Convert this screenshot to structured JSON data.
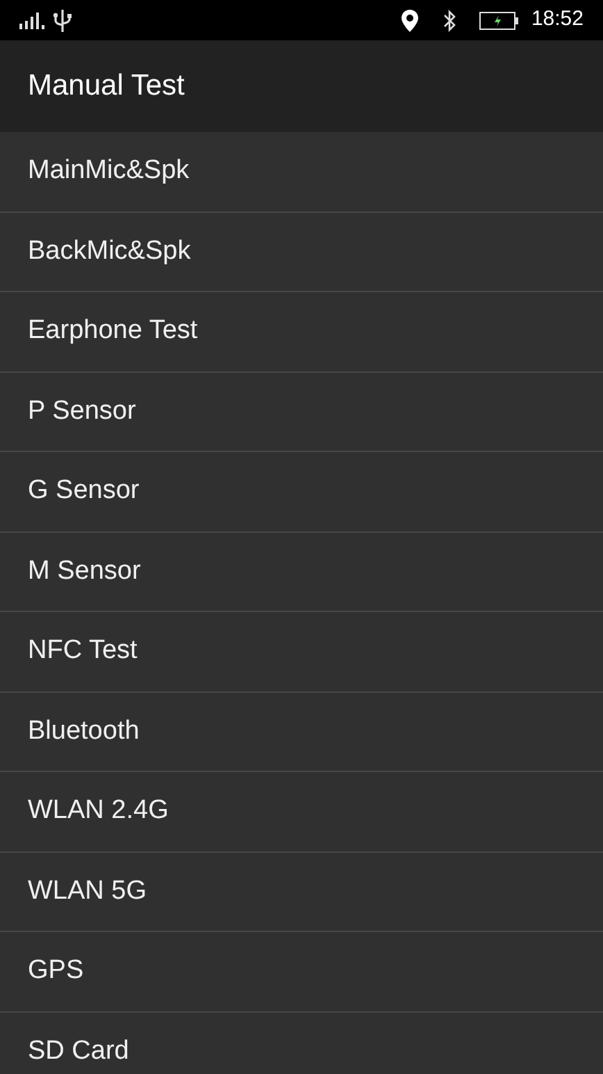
{
  "status_bar": {
    "time": "18:52"
  },
  "app_bar": {
    "title": "Manual Test"
  },
  "items": [
    {
      "label": "MainMic&Spk"
    },
    {
      "label": "BackMic&Spk"
    },
    {
      "label": "Earphone Test"
    },
    {
      "label": "P Sensor"
    },
    {
      "label": "G Sensor"
    },
    {
      "label": "M Sensor"
    },
    {
      "label": "NFC Test"
    },
    {
      "label": "Bluetooth"
    },
    {
      "label": "WLAN 2.4G"
    },
    {
      "label": "WLAN 5G"
    },
    {
      "label": "GPS"
    },
    {
      "label": "SD Card"
    }
  ]
}
